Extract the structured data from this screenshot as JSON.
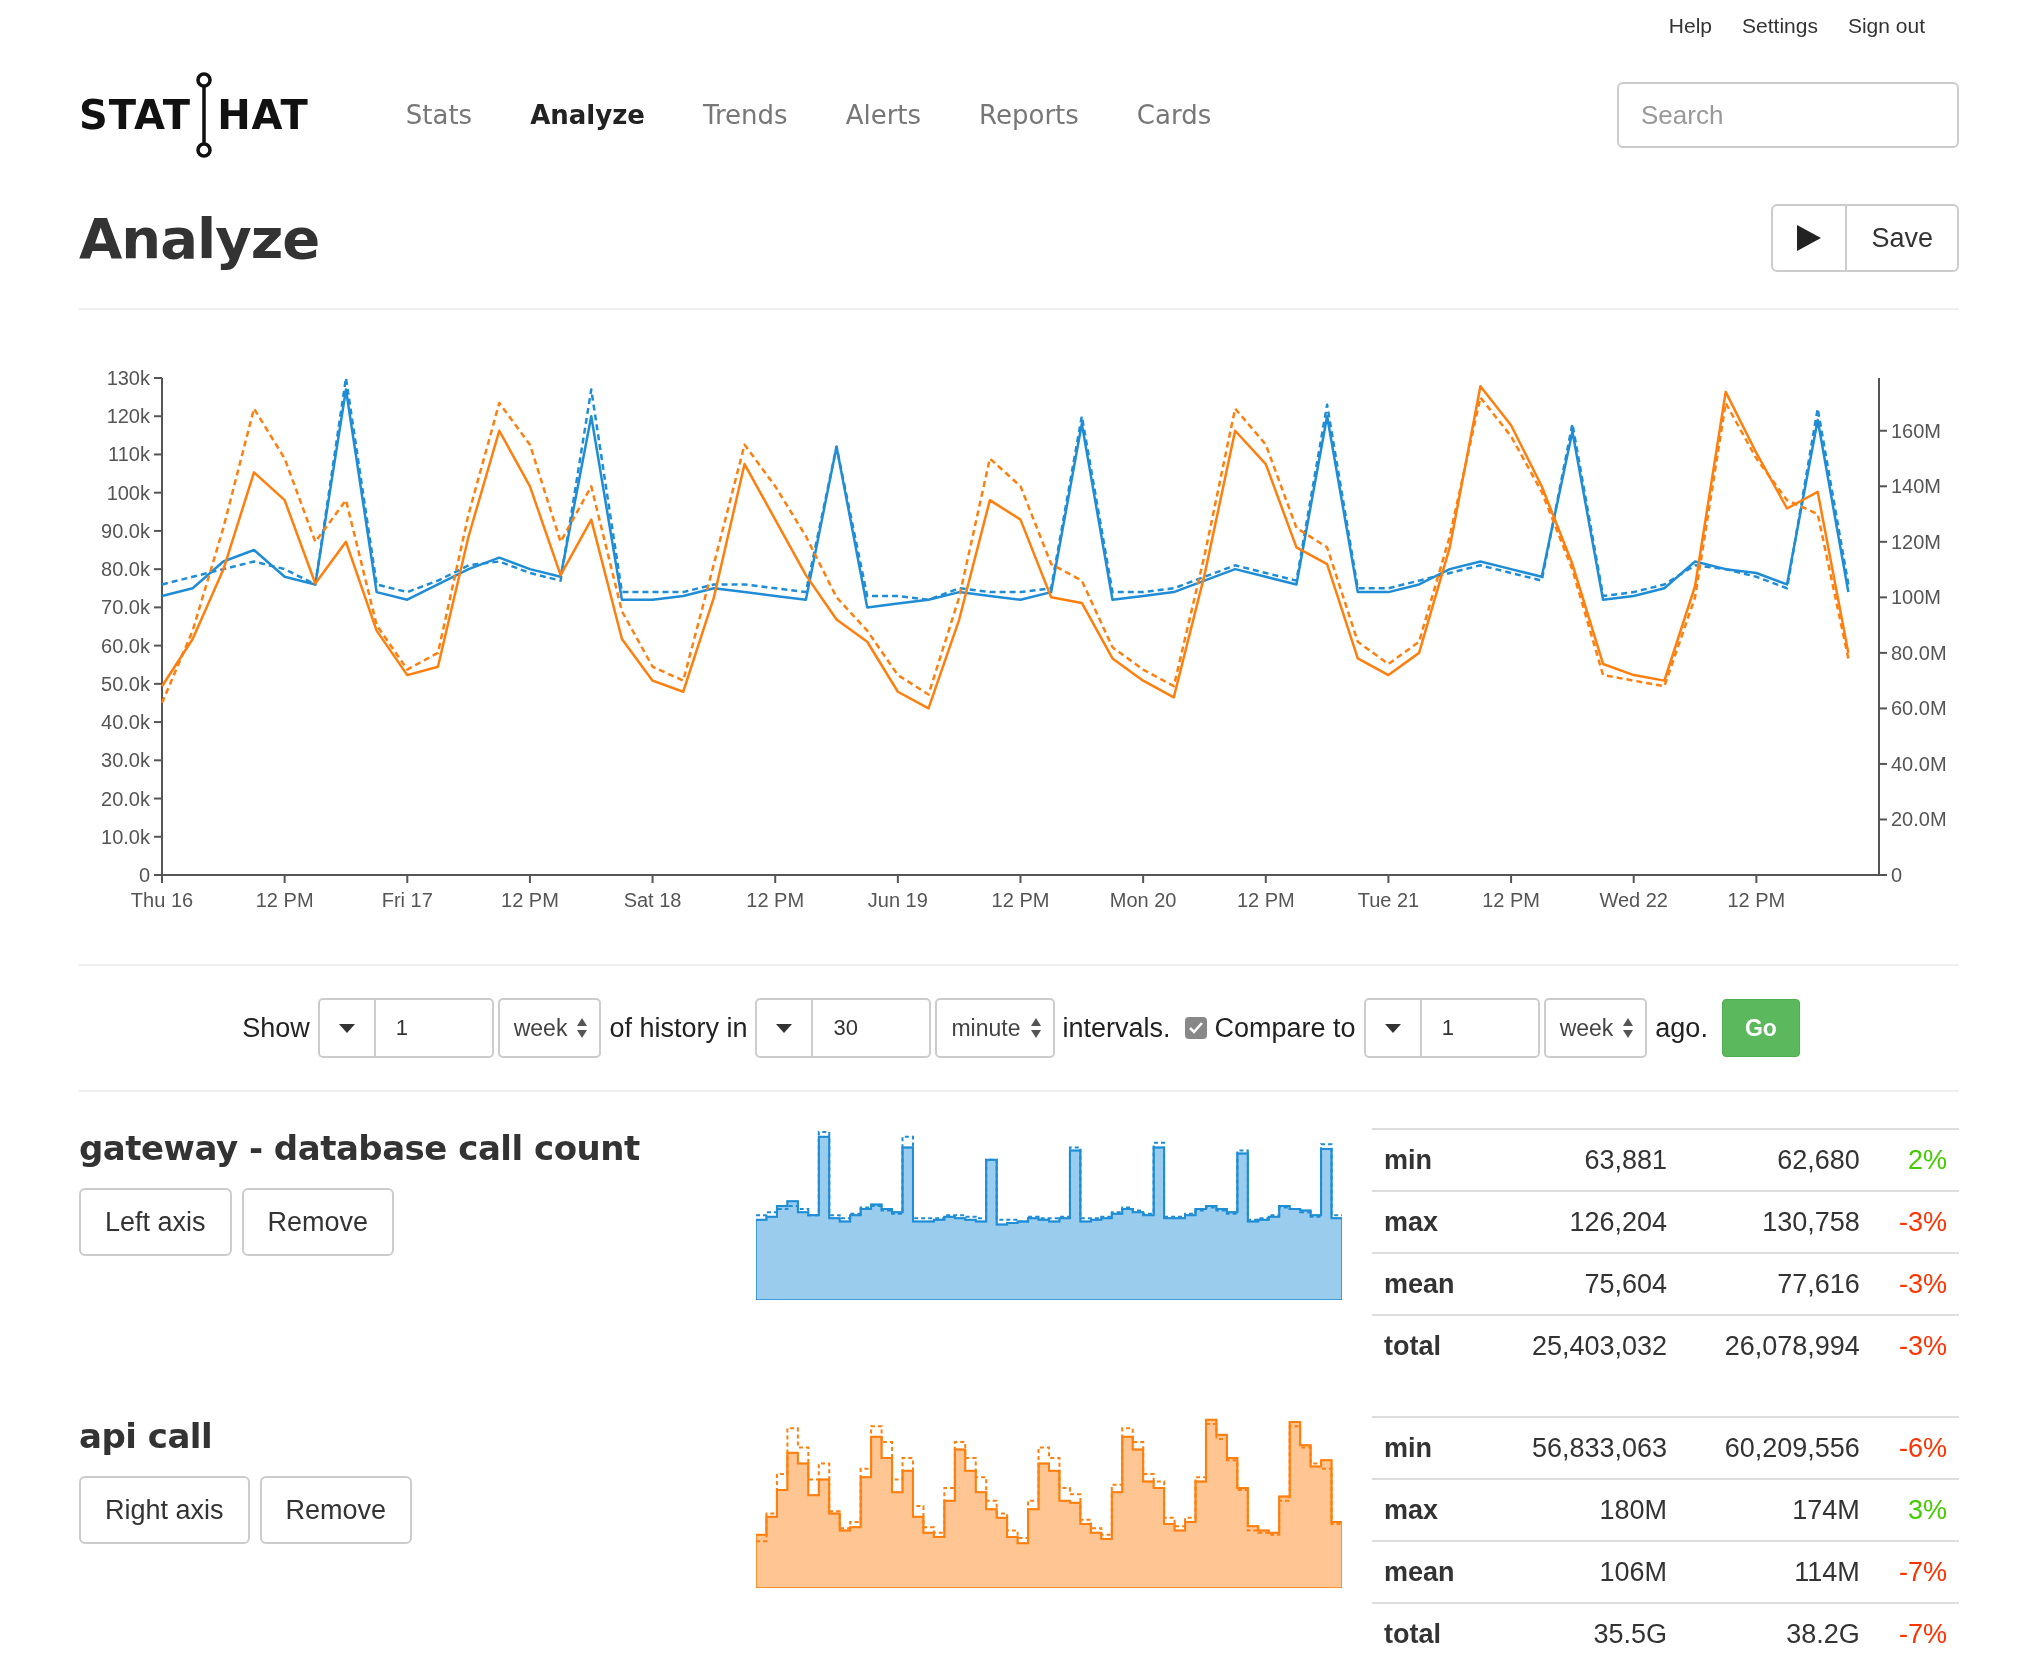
{
  "top_links": [
    "Help",
    "Settings",
    "Sign out"
  ],
  "logo": {
    "left": "STAT",
    "right": "HAT"
  },
  "nav": [
    {
      "label": "Stats",
      "selected": false
    },
    {
      "label": "Analyze",
      "selected": true
    },
    {
      "label": "Trends",
      "selected": false
    },
    {
      "label": "Alerts",
      "selected": false
    },
    {
      "label": "Reports",
      "selected": false
    },
    {
      "label": "Cards",
      "selected": false
    }
  ],
  "search": {
    "placeholder": "Search"
  },
  "page_title": "Analyze",
  "save_button": "Save",
  "chart": {
    "chart_data": {
      "type": "line",
      "ylim": [
        0,
        130
      ],
      "y2lim": [
        0,
        179
      ],
      "categories": [
        "Thu 16",
        null,
        null,
        null,
        "12 PM",
        null,
        null,
        null,
        "Fri 17",
        null,
        null,
        null,
        "12 PM",
        null,
        null,
        null,
        "Sat 18",
        null,
        null,
        null,
        "12 PM",
        null,
        null,
        null,
        "Jun 19",
        null,
        null,
        null,
        "12 PM",
        null,
        null,
        null,
        "Mon 20",
        null,
        null,
        null,
        "12 PM",
        null,
        null,
        null,
        "Tue 21",
        null,
        null,
        null,
        "12 PM",
        null,
        null,
        null,
        "Wed 22",
        null,
        null,
        null,
        "12 PM",
        null,
        null,
        null
      ],
      "yticks": [
        0,
        {
          "value": 10,
          "label": "10.0k"
        },
        {
          "value": 20,
          "label": "20.0k"
        },
        {
          "value": 30,
          "label": "30.0k"
        },
        {
          "value": 40,
          "label": "40.0k"
        },
        {
          "value": 50,
          "label": "50.0k"
        },
        {
          "value": 60,
          "label": "60.0k"
        },
        {
          "value": 70,
          "label": "70.0k"
        },
        {
          "value": 80,
          "label": "80.0k"
        },
        {
          "value": 90,
          "label": "90.0k"
        },
        {
          "value": 100,
          "label": "100k"
        },
        {
          "value": 110,
          "label": "110k"
        },
        {
          "value": 120,
          "label": "120k"
        },
        {
          "value": 130,
          "label": "130k"
        }
      ],
      "y2ticks": [
        0,
        {
          "value": 20,
          "label": "20.0M"
        },
        {
          "value": 40,
          "label": "40.0M"
        },
        {
          "value": 60,
          "label": "60.0M"
        },
        {
          "value": 80,
          "label": "80.0M"
        },
        {
          "value": 100,
          "label": "100M"
        },
        {
          "value": 120,
          "label": "120M"
        },
        {
          "value": 140,
          "label": "140M"
        },
        {
          "value": 160,
          "label": "160M"
        }
      ],
      "series": [
        {
          "color": "#1f8dd6",
          "line_style": "dashed",
          "values": [
            76,
            78,
            80,
            82,
            80,
            76,
            130,
            76,
            74,
            77,
            81,
            82,
            79,
            77,
            127,
            74,
            74,
            74,
            76,
            76,
            75,
            74,
            112,
            73,
            73,
            72,
            75,
            74,
            74,
            75,
            120,
            74,
            74,
            75,
            78,
            81,
            79,
            77,
            123,
            75,
            75,
            77,
            79,
            81,
            79,
            77,
            118,
            73,
            74,
            76,
            81,
            80,
            78,
            75,
            122,
            76
          ]
        },
        {
          "color": "#1f8dd6",
          "line_style": "solid",
          "values": [
            73,
            75,
            82,
            85,
            78,
            76,
            127,
            74,
            72,
            76,
            80,
            83,
            80,
            78,
            120,
            72,
            72,
            73,
            75,
            74,
            73,
            72,
            112,
            70,
            71,
            72,
            74,
            73,
            72,
            74,
            118,
            72,
            73,
            74,
            77,
            80,
            78,
            76,
            120,
            74,
            74,
            76,
            80,
            82,
            80,
            78,
            116,
            72,
            73,
            75,
            82,
            80,
            79,
            76,
            119,
            74
          ]
        },
        {
          "color": "#ff7f0e",
          "line_style": "dashed",
          "axis": "y2",
          "values": [
            62,
            88,
            125,
            168,
            150,
            120,
            135,
            90,
            74,
            80,
            130,
            170,
            155,
            120,
            140,
            95,
            75,
            70,
            112,
            155,
            140,
            122,
            100,
            88,
            72,
            65,
            100,
            150,
            140,
            112,
            106,
            82,
            74,
            68,
            115,
            168,
            155,
            125,
            118,
            84,
            76,
            84,
            122,
            172,
            158,
            138,
            110,
            72,
            70,
            68,
            100,
            170,
            150,
            135,
            130,
            78
          ]
        },
        {
          "color": "#ff7f0e",
          "line_style": "solid",
          "axis": "y2",
          "values": [
            68,
            85,
            110,
            145,
            135,
            105,
            120,
            88,
            72,
            75,
            122,
            160,
            140,
            108,
            128,
            85,
            70,
            66,
            100,
            148,
            128,
            108,
            92,
            84,
            66,
            60,
            92,
            135,
            128,
            100,
            98,
            78,
            70,
            64,
            108,
            160,
            148,
            118,
            112,
            78,
            72,
            80,
            118,
            176,
            162,
            140,
            112,
            76,
            72,
            70,
            104,
            174,
            152,
            132,
            138,
            80
          ]
        }
      ]
    }
  },
  "controls": [
    {
      "kind": "text",
      "text": "Show"
    },
    {
      "kind": "stepper"
    },
    {
      "kind": "number",
      "value": "1"
    },
    {
      "kind": "select",
      "value": "week"
    },
    {
      "kind": "text",
      "text": "of history in"
    },
    {
      "kind": "stepper"
    },
    {
      "kind": "number",
      "value": "30"
    },
    {
      "kind": "select",
      "value": "minute"
    },
    {
      "kind": "text",
      "text": "intervals."
    },
    {
      "kind": "checkbox",
      "checked": true
    },
    {
      "kind": "text",
      "text": "Compare to"
    },
    {
      "kind": "stepper"
    },
    {
      "kind": "number",
      "value": "1"
    },
    {
      "kind": "select",
      "value": "week"
    },
    {
      "kind": "text",
      "text": "ago."
    },
    {
      "kind": "button",
      "text": "Go"
    }
  ],
  "sections": [
    {
      "name": "gateway - database call count",
      "axis_button": "Left axis",
      "remove_button": "Remove",
      "stats": [
        {
          "label": "min",
          "current": "63,881",
          "previous": "62,680",
          "change": "2%",
          "color": "#44cc00"
        },
        {
          "label": "max",
          "current": "126,204",
          "previous": "130,758",
          "change": "-3%",
          "color": "#ff3300"
        },
        {
          "label": "mean",
          "current": "75,604",
          "previous": "77,616",
          "change": "-3%",
          "color": "#ff3300"
        },
        {
          "label": "total",
          "current": "25,403,032",
          "previous": "26,078,994",
          "change": "-3%",
          "color": "#ff3300"
        }
      ]
    },
    {
      "name": "api call",
      "axis_button": "Right axis",
      "remove_button": "Remove",
      "stats": [
        {
          "label": "min",
          "current": "56,833,063",
          "previous": "60,209,556",
          "change": "-6%",
          "color": "#ff3300"
        },
        {
          "label": "max",
          "current": "180M",
          "previous": "174M",
          "change": "3%",
          "color": "#44cc00"
        },
        {
          "label": "mean",
          "current": "106M",
          "previous": "114M",
          "change": "-7%",
          "color": "#ff3300"
        },
        {
          "label": "total",
          "current": "35.5G",
          "previous": "38.2G",
          "change": "-7%",
          "color": "#ff3300"
        }
      ]
    }
  ]
}
